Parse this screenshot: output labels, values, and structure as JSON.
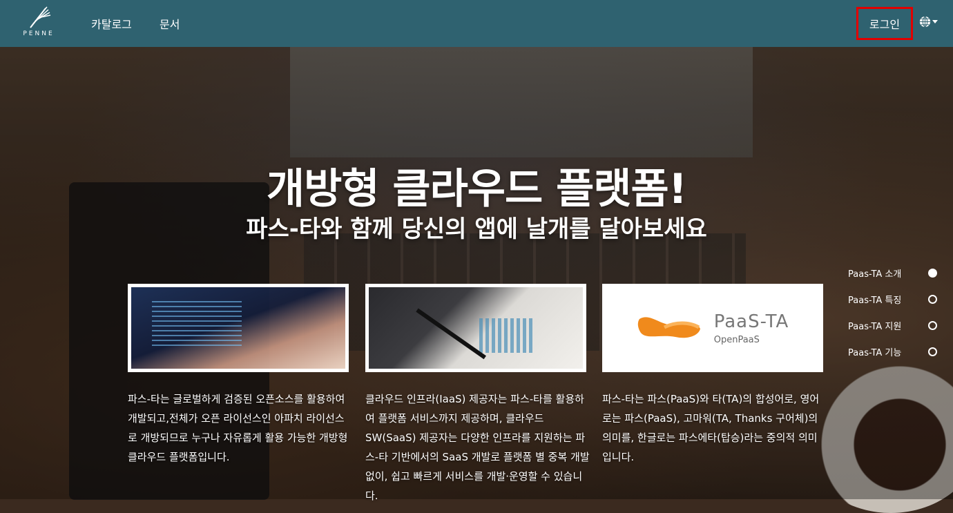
{
  "header": {
    "logo_text": "PENNE",
    "nav": [
      {
        "label": "카탈로그"
      },
      {
        "label": "문서"
      }
    ],
    "login_label": "로그인",
    "language_icon": "globe-icon"
  },
  "hero": {
    "title": "개방형 클라우드 플랫폼!",
    "subtitle": "파스-타와 함께 당신의 앱에 날개를 달아보세요"
  },
  "cards": [
    {
      "image": "coding-laptop-photo",
      "text": "파스-타는 글로벌하게 검증된 오픈소스를 활용하여 개발되고,전체가 오픈 라이선스인 아파치 라이선스로 개방되므로 누구나 자유롭게 활용 가능한 개방형 클라우드 플랫폼입니다."
    },
    {
      "image": "business-chart-photo",
      "text": "클라우드 인프라(IaaS) 제공자는 파스-타를 활용하여 플랫폼 서비스까지 제공하며, 클라우드 SW(SaaS) 제공자는 다양한 인프라를 지원하는 파스-타 기반에서의 SaaS 개발로 플랫폼 별 중복 개발 없이, 쉽고 빠르게 서비스를 개발·운영할 수 있습니다."
    },
    {
      "image": "paasta-logo",
      "logo_title": "PaaS-TA",
      "logo_subtitle": "OpenPaaS",
      "text": "파스-타는 파스(PaaS)와 타(TA)의 합성어로, 영어로는 파스(PaaS), 고마워(TA, Thanks 구어체)의 의미를, 한글로는 파스에타(탑승)라는 중의적 의미입니다."
    }
  ],
  "side_nav": [
    {
      "label": "Paas-TA 소개",
      "active": true
    },
    {
      "label": "Paas-TA 특징",
      "active": false
    },
    {
      "label": "Paas-TA 지원",
      "active": false
    },
    {
      "label": "Paas-TA 기능",
      "active": false
    }
  ],
  "colors": {
    "navbar": "#2f6270",
    "login_highlight": "#e10000",
    "paasta_orange": "#f08a1c"
  }
}
